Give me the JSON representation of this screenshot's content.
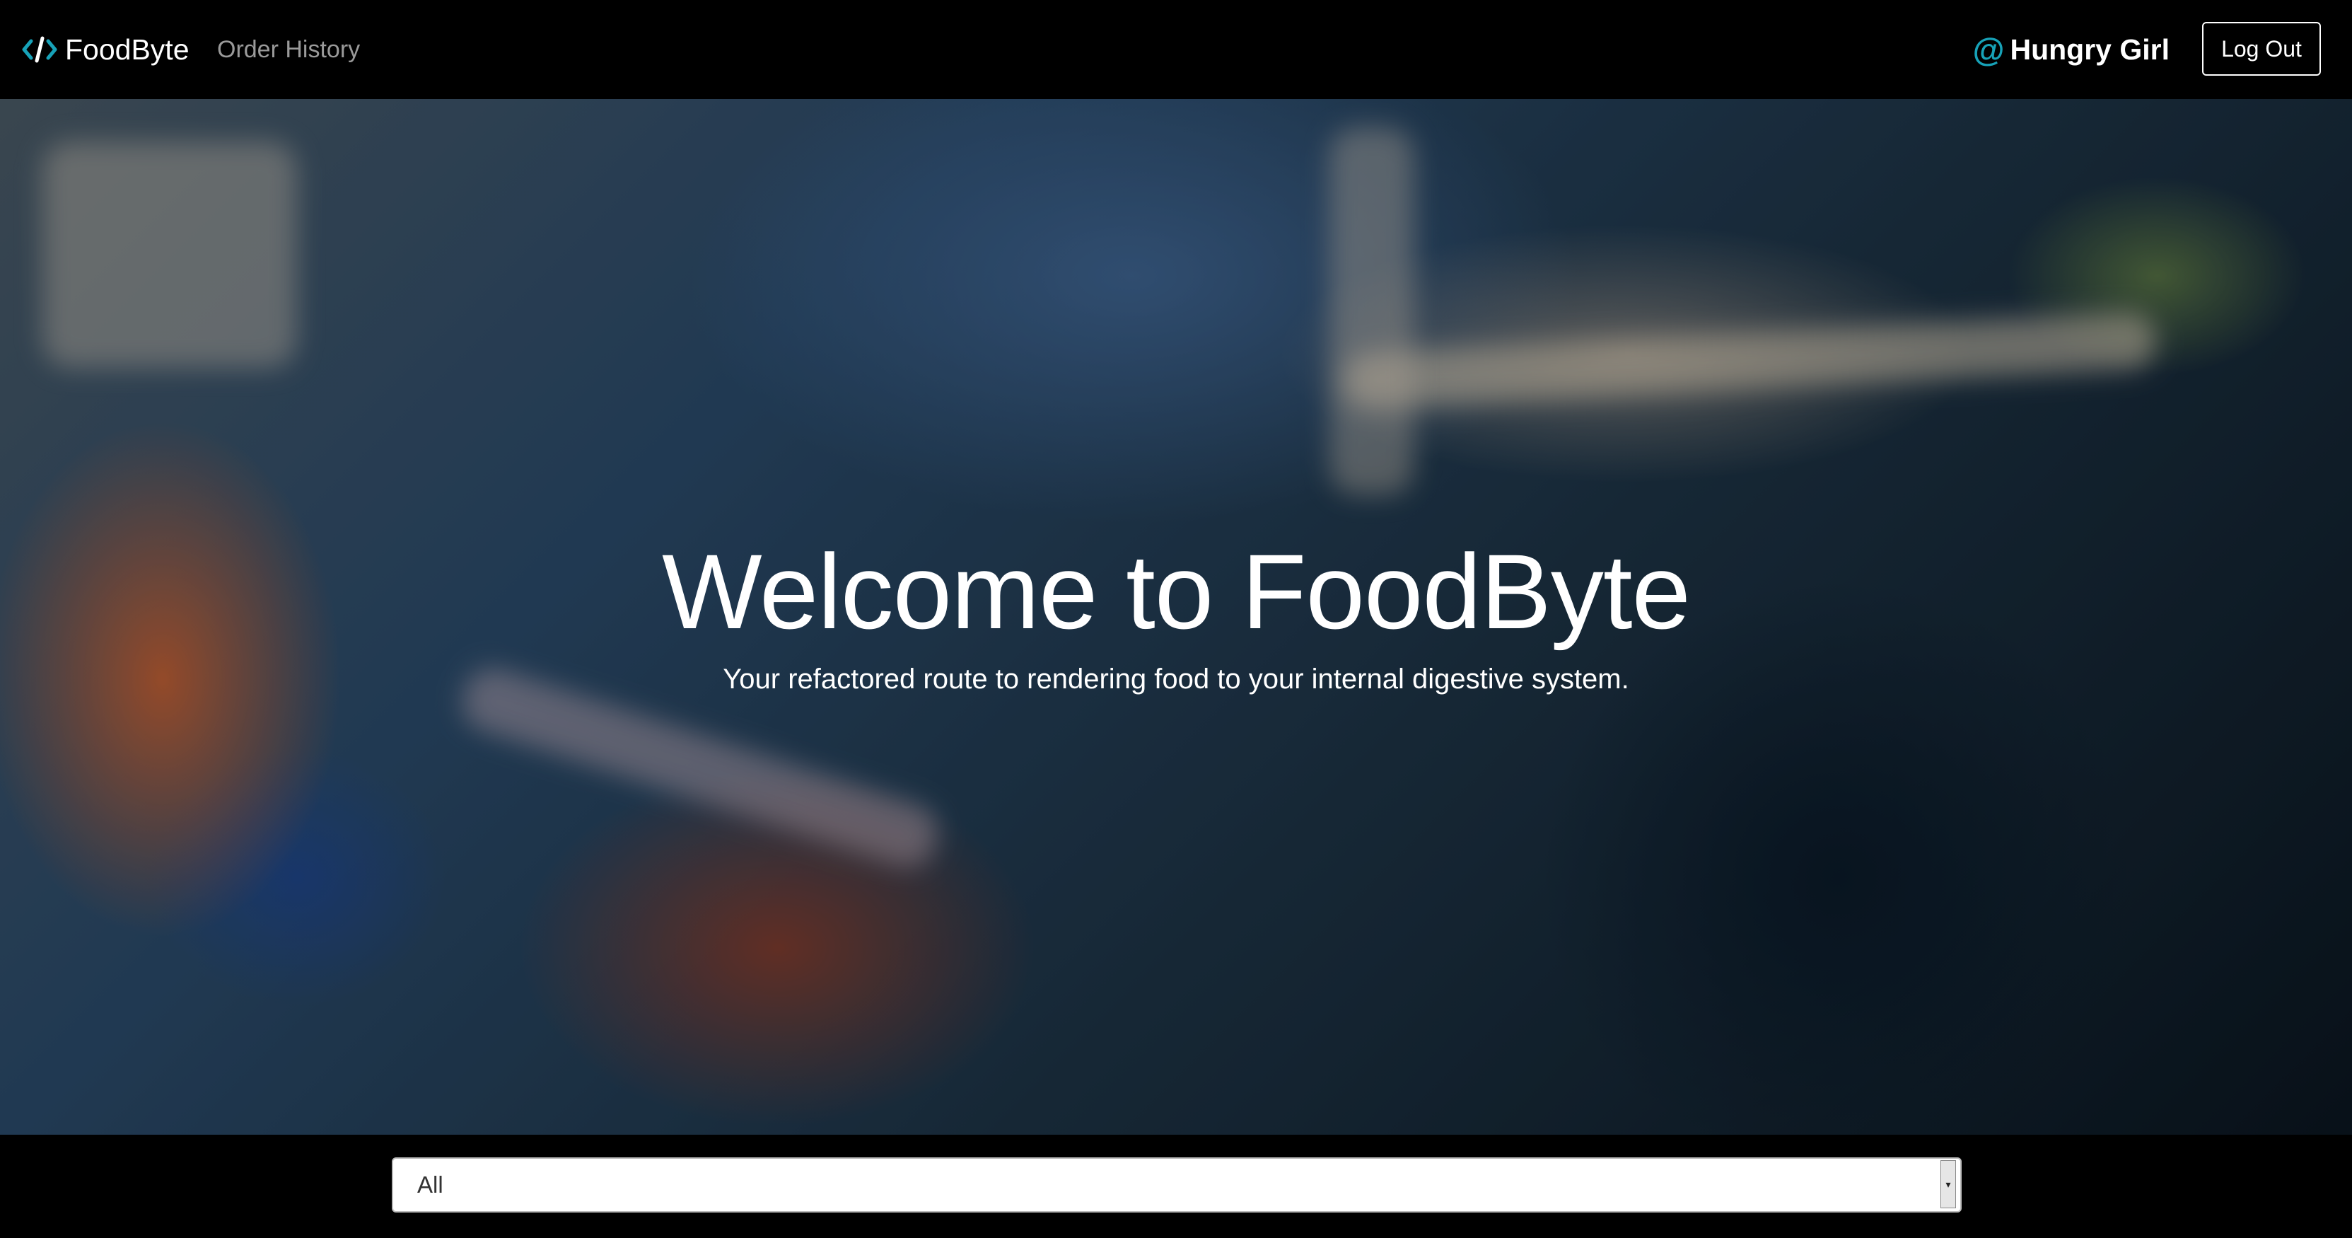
{
  "navbar": {
    "brand_icon": "code-icon",
    "brand_name": "FoodByte",
    "links": [
      {
        "label": "Order History"
      }
    ],
    "user_icon": "at-icon",
    "user_name": "Hungry Girl",
    "logout_label": "Log Out"
  },
  "hero": {
    "title": "Welcome to FoodByte",
    "subtitle": "Your refactored route to rendering food to your internal digestive system."
  },
  "filter": {
    "selected": "All",
    "arrow_icon": "chevron-down-icon"
  },
  "colors": {
    "accent": "#17a2b8",
    "navbar_bg": "#000000",
    "nav_link": "#9a9a9a"
  }
}
